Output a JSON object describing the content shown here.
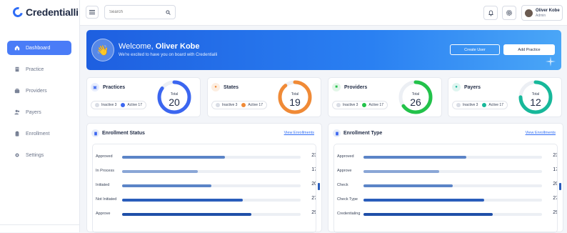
{
  "brand": {
    "name": "Credentialli",
    "accent": "#2f6df6"
  },
  "sidebar": {
    "items": [
      {
        "label": "Dashboard",
        "icon": "home-icon",
        "active": true
      },
      {
        "label": "Practice",
        "icon": "building-icon",
        "active": false
      },
      {
        "label": "Providers",
        "icon": "briefcase-icon",
        "active": false
      },
      {
        "label": "Payers",
        "icon": "users-icon",
        "active": false
      },
      {
        "label": "Enrollment",
        "icon": "clipboard-icon",
        "active": false
      },
      {
        "label": "Settings",
        "icon": "gear-icon",
        "active": false
      }
    ]
  },
  "topbar": {
    "search_placeholder": "Search",
    "user": {
      "name": "Oliver Kobe",
      "role": "Admin"
    }
  },
  "hero": {
    "greeting": "Welcome,",
    "name": "Oliver Kobe",
    "subtitle": "We're excited to have you on board with Credentialli",
    "create_user": "Create User",
    "add_practice": "Add Practice"
  },
  "stats": [
    {
      "title": "Practices",
      "inactive": "Inactive 3",
      "active": "Active 17",
      "total_label": "Total",
      "total": "20",
      "color": "#3b66f0",
      "fraction": 0.85
    },
    {
      "title": "States",
      "inactive": "Inactive 3",
      "active": "Active 17",
      "total_label": "Total",
      "total": "19",
      "color": "#f08a36",
      "fraction": 0.89
    },
    {
      "title": "Providers",
      "inactive": "Inactive 3",
      "active": "Active 17",
      "total_label": "Total",
      "total": "26",
      "color": "#22c24a",
      "fraction": 0.65
    },
    {
      "title": "Payers",
      "inactive": "Inactive 3",
      "active": "Active 17",
      "total_label": "Total",
      "total": "12",
      "color": "#17b89a",
      "fraction": 0.75
    }
  ],
  "enrollment_status": {
    "title": "Enrollment Status",
    "link": "View Enrollments",
    "rows": [
      {
        "label": "Approved",
        "value": 23,
        "color": "#5b84c7"
      },
      {
        "label": "In Process",
        "value": 17,
        "color": "#8aa6d6"
      },
      {
        "label": "Initiated",
        "value": 20,
        "color": "#5b84c7"
      },
      {
        "label": "Not Initiated",
        "value": 27,
        "color": "#2a5dbb"
      },
      {
        "label": "Approve",
        "value": 29,
        "color": "#1f4fa8"
      }
    ]
  },
  "enrollment_type": {
    "title": "Enrollment Type",
    "link": "View Enrollments",
    "rows": [
      {
        "label": "Approved",
        "value": 23,
        "color": "#5b84c7"
      },
      {
        "label": "Approve",
        "value": 17,
        "color": "#8aa6d6"
      },
      {
        "label": "Check",
        "value": 20,
        "color": "#5b84c7"
      },
      {
        "label": "Check Type",
        "value": 27,
        "color": "#2a5dbb"
      },
      {
        "label": "Credentialing",
        "value": 29,
        "color": "#1f4fa8"
      }
    ]
  }
}
